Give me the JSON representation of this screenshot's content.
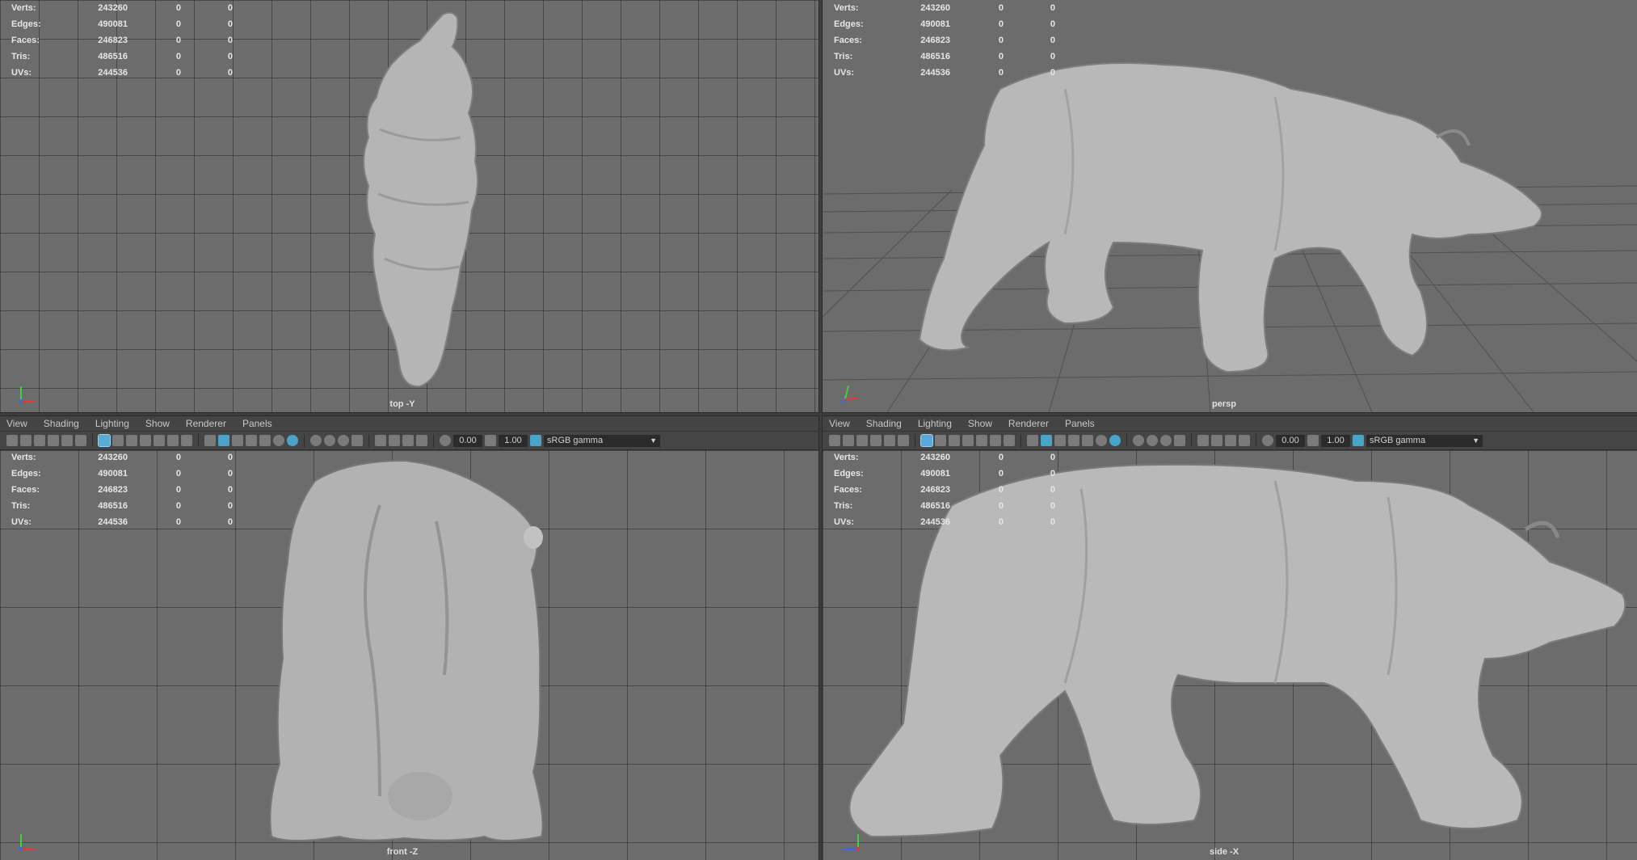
{
  "menu": [
    "View",
    "Shading",
    "Lighting",
    "Show",
    "Renderer",
    "Panels"
  ],
  "hud_labels": [
    "Verts:",
    "Edges:",
    "Faces:",
    "Tris:",
    "UVs:"
  ],
  "hud_values": [
    [
      "243260",
      "0",
      "0"
    ],
    [
      "490081",
      "0",
      "0"
    ],
    [
      "246823",
      "0",
      "0"
    ],
    [
      "486516",
      "0",
      "0"
    ],
    [
      "244536",
      "0",
      "0"
    ]
  ],
  "toolbar": {
    "exposure": "0.00",
    "gamma": "1.00",
    "color_space": "sRGB gamma"
  },
  "views": {
    "top": "top -Y",
    "persp": "persp",
    "front": "front -Z",
    "side": "side -X"
  },
  "colors": {
    "viewport_bg": "#6c6c6c",
    "model": "#b8b8b8",
    "accent": "#4aa3c9"
  },
  "icons": [
    "camera-icon",
    "grid-icon",
    "wireframe-icon",
    "smooth-shade-icon",
    "texture-icon",
    "light-icon",
    "isolate-icon",
    "xray-icon",
    "exposure-icon",
    "gamma-icon",
    "color-space-icon"
  ]
}
